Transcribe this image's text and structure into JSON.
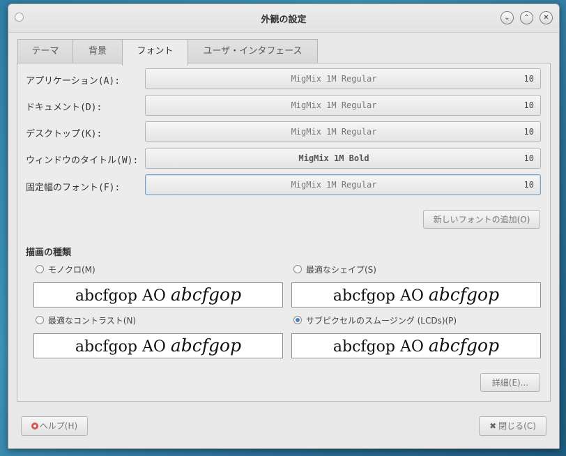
{
  "window": {
    "title": "外観の設定"
  },
  "tabs": [
    {
      "label": "テーマ"
    },
    {
      "label": "背景"
    },
    {
      "label": "フォント"
    },
    {
      "label": "ユーザ・インタフェース"
    }
  ],
  "fonts": [
    {
      "label": "アプリケーション(A):",
      "font": "MigMix 1M Regular",
      "size": "10"
    },
    {
      "label": "ドキュメント(D):",
      "font": "MigMix 1M Regular",
      "size": "10"
    },
    {
      "label": "デスクトップ(K):",
      "font": "MigMix 1M Regular",
      "size": "10"
    },
    {
      "label": "ウィンドウのタイトル(W):",
      "font": "MigMix 1M Bold",
      "size": "10"
    },
    {
      "label": "固定幅のフォント(F):",
      "font": "MigMix 1M Regular",
      "size": "10"
    }
  ],
  "add_font_button": "新しいフォントの追加(O)",
  "rendering": {
    "title": "描画の種類",
    "sample_regular": "abcfgop AO",
    "sample_italic": "abcfgop",
    "options": [
      {
        "label": "モノクロ(M)",
        "checked": false
      },
      {
        "label": "最適なシェイプ(S)",
        "checked": false
      },
      {
        "label": "最適なコントラスト(N)",
        "checked": false
      },
      {
        "label": "サブピクセルのスムージング (LCDs)(P)",
        "checked": true
      }
    ]
  },
  "details_button": "詳細(E)...",
  "help_button": "ヘルプ(H)",
  "close_button": "閉じる(C)",
  "icons": {
    "help": "help-lifebuoy-icon",
    "close": "close-x-icon"
  },
  "colors": {
    "accent": "#4f82c0",
    "background": "#e8e8e8"
  }
}
